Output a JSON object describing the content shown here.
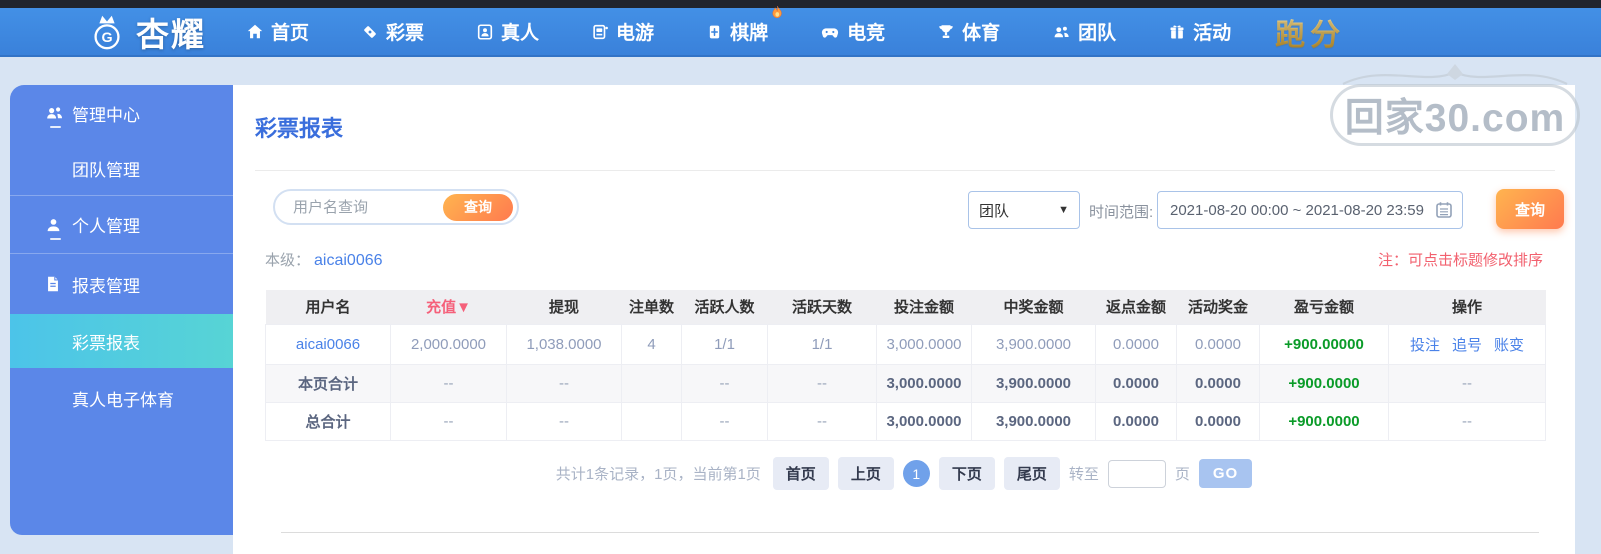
{
  "colors": {
    "nav_blue": "#3d86de",
    "sidebar_blue": "#5b87e8",
    "active_item_cyan": "#52cde0",
    "accent_orange_start": "#ffb44f",
    "accent_orange_end": "#ff7a4f",
    "link_blue": "#4a82e8",
    "title_blue": "#3a6edc",
    "profit_green": "#0a9b28",
    "alert_red": "#f2606e",
    "gold": "#c9a244"
  },
  "nav": {
    "logo_text": "杏耀",
    "items": [
      {
        "label": "首页",
        "icon": "home-icon"
      },
      {
        "label": "彩票",
        "icon": "lottery-ticket-icon"
      },
      {
        "label": "真人",
        "icon": "live-person-icon"
      },
      {
        "label": "电游",
        "icon": "slot-machine-icon"
      },
      {
        "label": "棋牌",
        "icon": "mahjong-tile-icon",
        "badge": "hot"
      },
      {
        "label": "电竞",
        "icon": "gamepad-icon"
      },
      {
        "label": "体育",
        "icon": "trophy-icon"
      },
      {
        "label": "团队",
        "icon": "team-icon"
      },
      {
        "label": "活动",
        "icon": "gift-icon"
      }
    ],
    "highlight_item": "跑分"
  },
  "watermark": {
    "text": "回家30.com"
  },
  "sidebar": {
    "items": [
      {
        "label": "管理中心"
      },
      {
        "label": "团队管理"
      },
      {
        "label": "个人管理"
      },
      {
        "label": "报表管理"
      },
      {
        "label": "彩票报表"
      },
      {
        "label": "真人电子体育"
      }
    ]
  },
  "main": {
    "title": "彩票报表",
    "search": {
      "placeholder": "用户名查询",
      "button": "查询"
    },
    "filters": {
      "scope_value": "团队",
      "scope_caret": "▼",
      "range_label": "时间范围:",
      "range_value": "2021-08-20 00:00 ~ 2021-08-20 23:59",
      "submit": "查询"
    },
    "level": {
      "label": "本级：",
      "value": "aicai0066"
    },
    "note": "注：可点击标题修改排序",
    "table": {
      "headers": [
        "用户名",
        "充值",
        "提现",
        "注单数",
        "活跃人数",
        "活跃天数",
        "投注金额",
        "中奖金额",
        "返点金额",
        "活动奖金",
        "盈亏金额",
        "操作"
      ],
      "sort_indicator": "▼",
      "rows": [
        {
          "cells": [
            "aicai0066",
            "2,000.0000",
            "1,038.0000",
            "4",
            "1/1",
            "1/1",
            "3,000.0000",
            "3,900.0000",
            "0.0000",
            "0.0000",
            "+900.00000"
          ],
          "actions": [
            "投注",
            "追号",
            "账变"
          ]
        },
        {
          "cells": [
            "本页合计",
            "--",
            "--",
            "",
            "--",
            "--",
            "3,000.0000",
            "3,900.0000",
            "0.0000",
            "0.0000",
            "+900.0000"
          ],
          "op": "--"
        },
        {
          "cells": [
            "总合计",
            "--",
            "--",
            "",
            "--",
            "--",
            "3,000.0000",
            "3,900.0000",
            "0.0000",
            "0.0000",
            "+900.0000"
          ],
          "op": "--"
        }
      ]
    },
    "pagination": {
      "summary": "共计1条记录，1页，当前第1页",
      "first": "首页",
      "prev": "上页",
      "current": "1",
      "next": "下页",
      "last": "尾页",
      "goto_label": "转至",
      "page_label": "页",
      "go": "GO"
    }
  }
}
